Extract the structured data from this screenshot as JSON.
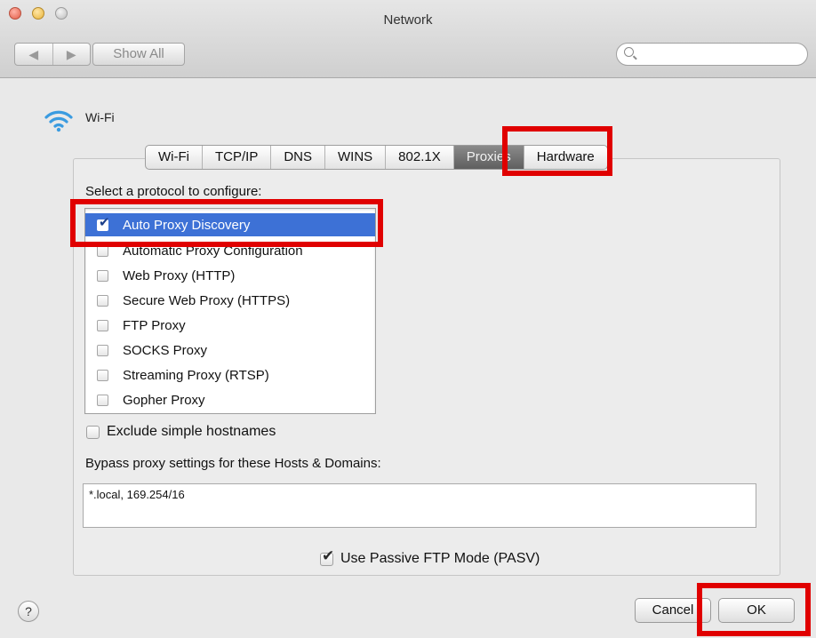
{
  "window": {
    "title": "Network"
  },
  "toolbar": {
    "back_glyph": "◀",
    "forward_glyph": "▶",
    "show_all_label": "Show All",
    "search_placeholder": ""
  },
  "background": {
    "interface_name": "Wi-Fi"
  },
  "tabs": [
    {
      "label": "Wi-Fi"
    },
    {
      "label": "TCP/IP"
    },
    {
      "label": "DNS"
    },
    {
      "label": "WINS"
    },
    {
      "label": "802.1X"
    },
    {
      "label": "Proxies",
      "active": true
    },
    {
      "label": "Hardware"
    }
  ],
  "proxies": {
    "select_label": "Select a protocol to configure:",
    "protocols": [
      {
        "label": "Auto Proxy Discovery",
        "checked": true,
        "selected": true
      },
      {
        "label": "Automatic Proxy Configuration",
        "checked": false
      },
      {
        "label": "Web Proxy (HTTP)",
        "checked": false
      },
      {
        "label": "Secure Web Proxy (HTTPS)",
        "checked": false
      },
      {
        "label": "FTP Proxy",
        "checked": false
      },
      {
        "label": "SOCKS Proxy",
        "checked": false
      },
      {
        "label": "Streaming Proxy (RTSP)",
        "checked": false
      },
      {
        "label": "Gopher Proxy",
        "checked": false
      }
    ],
    "exclude_simple_label": "Exclude simple hostnames",
    "exclude_simple_checked": false,
    "bypass_label": "Bypass proxy settings for these Hosts & Domains:",
    "bypass_value": "*.local, 169.254/16",
    "passive_ftp_label": "Use Passive FTP Mode (PASV)",
    "passive_ftp_checked": true
  },
  "footer": {
    "help_label": "?",
    "cancel_label": "Cancel",
    "ok_label": "OK"
  },
  "colors": {
    "highlight_box": "#e00000",
    "selection": "#3d71d6"
  }
}
